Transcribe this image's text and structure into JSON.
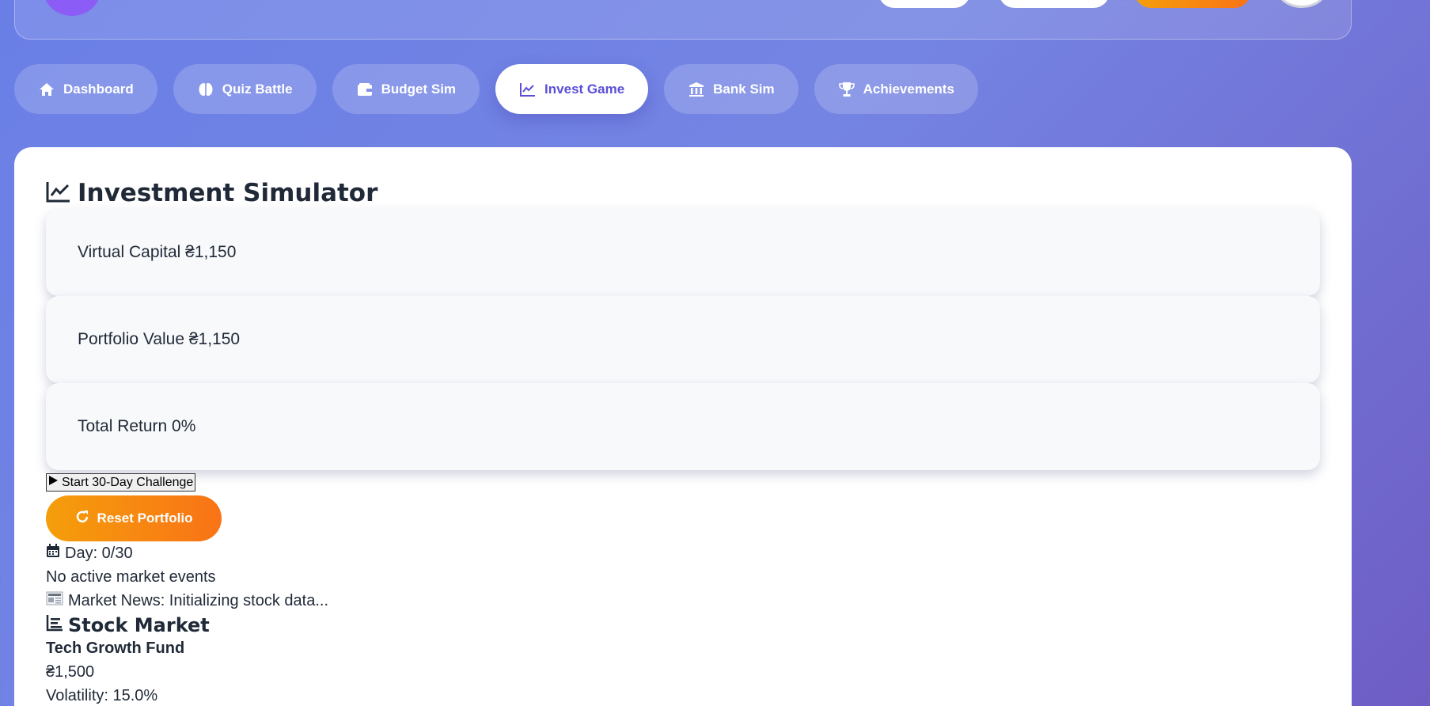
{
  "nav": {
    "tabs": [
      {
        "label": "Dashboard",
        "icon": "home-icon"
      },
      {
        "label": "Quiz Battle",
        "icon": "brain-icon"
      },
      {
        "label": "Budget Sim",
        "icon": "wallet-icon"
      },
      {
        "label": "Invest Game",
        "icon": "chart-line-icon",
        "active": true
      },
      {
        "label": "Bank Sim",
        "icon": "bank-icon"
      },
      {
        "label": "Achievements",
        "icon": "trophy-icon"
      }
    ]
  },
  "main": {
    "title": "Investment Simulator",
    "stats": [
      {
        "label": "Virtual Capital ₴1,150"
      },
      {
        "label": "Portfolio Value ₴1,150"
      },
      {
        "label": "Total Return 0%"
      }
    ],
    "start_label": "Start 30-Day Challenge",
    "reset_label": "Reset Portfolio",
    "day": "Day: 0/30",
    "events": "No active market events",
    "news": "Market News: Initializing stock data...",
    "market_title": "Stock Market",
    "fund": {
      "name": "Tech Growth Fund",
      "price": "₴1,500",
      "volatility": "Volatility: 15.0%"
    }
  },
  "colors": {
    "accent": "#5b4fd6",
    "orange": "#f97316",
    "bg_start": "#6a7fe6",
    "bg_end": "#6e5dc4"
  }
}
